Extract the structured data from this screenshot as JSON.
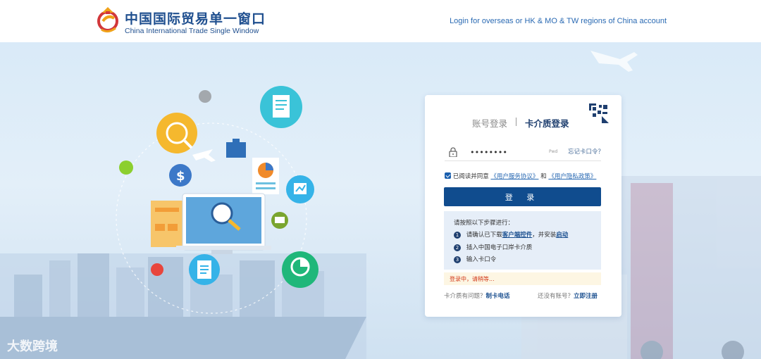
{
  "header": {
    "brand_cn": "中国国际贸易单一窗口",
    "brand_en": "China International Trade Single Window",
    "overseas_link": "Login for overseas or HK & MO & TW regions of China account"
  },
  "login_card": {
    "tab_account": "账号登录",
    "tab_card": "卡介质登录",
    "password_value": "••••••••",
    "password_tag": "Pwd",
    "forgot_link": "忘记卡口令？",
    "agree_prefix": "已阅读并同意",
    "agree_terms": "《用户服务协议》",
    "agree_and": "和",
    "agree_privacy": "《用户隐私政策》",
    "login_button": "登 录",
    "steps_title": "请按照以下步骤进行：",
    "step1_prefix": "请确认已下载",
    "step1_link1": "客户端控件",
    "step1_mid": "，并安装",
    "step1_link2": "启动",
    "step2": "插入中国电子口岸卡介质",
    "step3": "输入卡口令",
    "step_nums": [
      "1",
      "2",
      "3"
    ],
    "status": "登录中，请稍等...",
    "foot_left_prefix": "卡介质有问题？",
    "foot_left_link": "制卡电话",
    "foot_right_prefix": "还没有账号？",
    "foot_right_link": "立即注册"
  },
  "watermark": "大数跨境",
  "colors": {
    "brand_blue": "#1f4f8f",
    "button_blue": "#104c8e",
    "status_red": "#d23a1a"
  }
}
